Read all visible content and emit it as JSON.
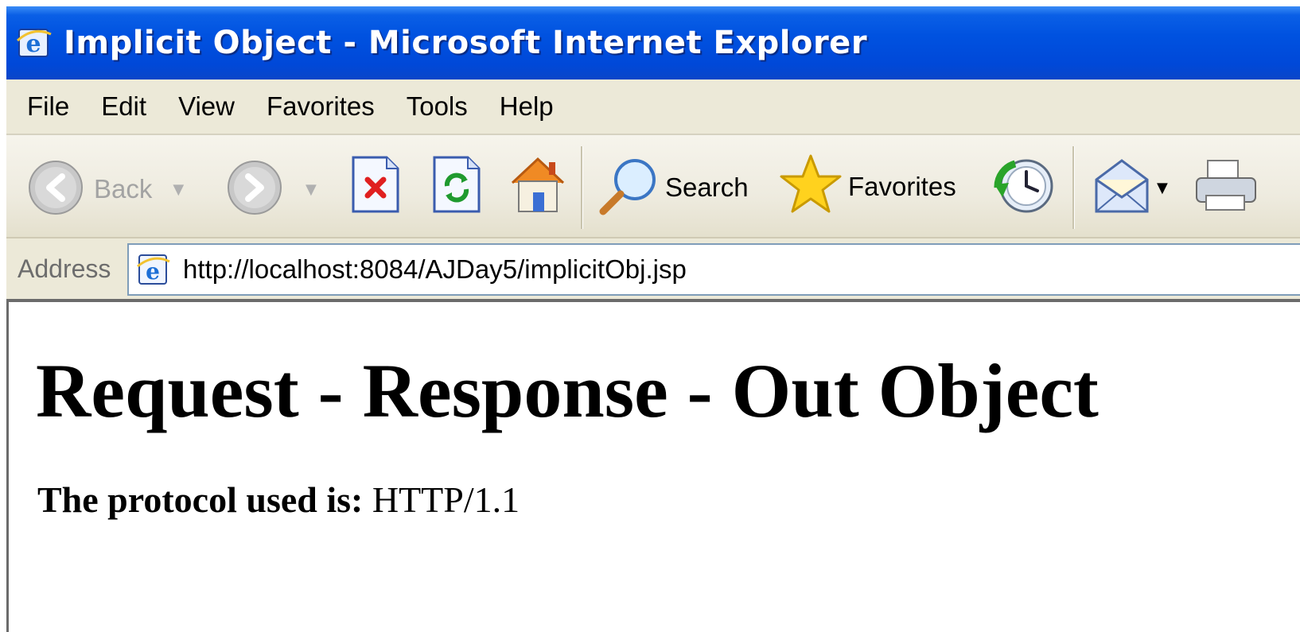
{
  "window": {
    "title": "Implicit Object - Microsoft Internet Explorer",
    "title_icon": "ie-icon",
    "titlebar_color": "#0052e0"
  },
  "menu": {
    "items": [
      "File",
      "Edit",
      "View",
      "Favorites",
      "Tools",
      "Help"
    ]
  },
  "toolbar": {
    "back_label": "Back",
    "search_label": "Search",
    "favorites_label": "Favorites",
    "icons": [
      "back-icon",
      "forward-icon",
      "stop-icon",
      "refresh-icon",
      "home-icon",
      "search-icon",
      "favorites-icon",
      "history-icon",
      "mail-icon",
      "print-icon"
    ]
  },
  "address": {
    "label": "Address",
    "url": "http://localhost:8084/AJDay5/implicitObj.jsp"
  },
  "page": {
    "heading": "Request - Response - Out Object",
    "protocol_label": "The protocol used is:",
    "protocol_value": "HTTP/1.1"
  }
}
